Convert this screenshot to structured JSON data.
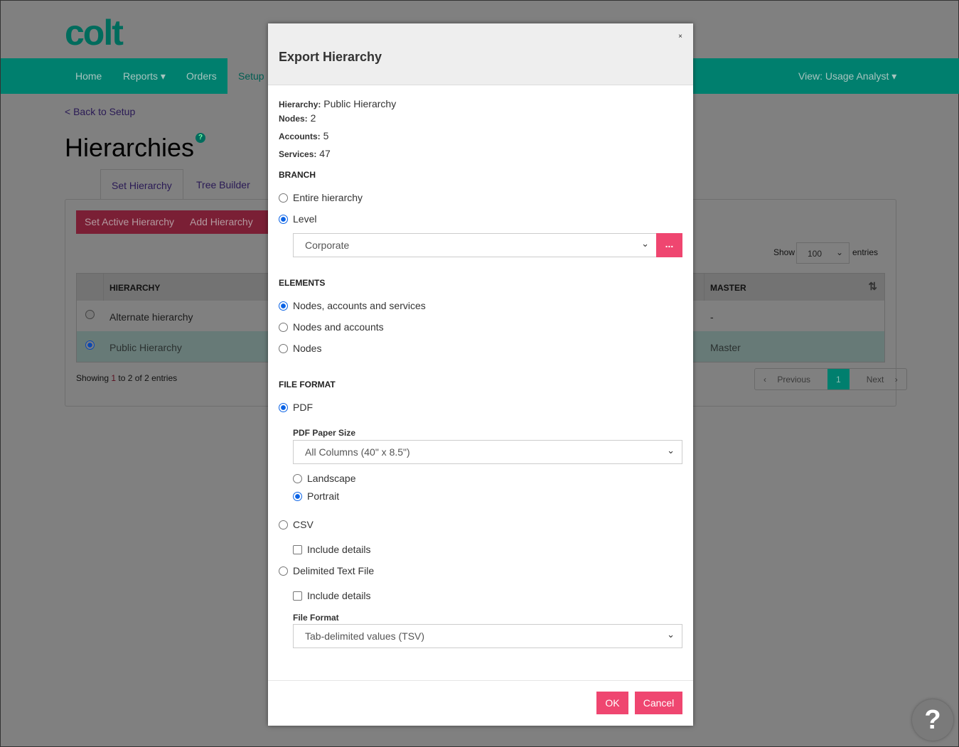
{
  "logo": "colt",
  "nav": {
    "items": [
      "Home",
      "Reports",
      "Orders",
      "Setup"
    ],
    "view": "View: Usage Analyst"
  },
  "back_link": "< Back to Setup",
  "page_title": "Hierarchies",
  "help_badge": "?",
  "tabs": [
    "Set Hierarchy",
    "Tree Builder"
  ],
  "buttons": [
    "Set Active Hierarchy",
    "Add Hierarchy"
  ],
  "show_entries": {
    "show": "Show",
    "value": "100",
    "entries": "entries"
  },
  "table": {
    "headers": [
      "HIERARCHY",
      "MASTER"
    ],
    "rows": [
      {
        "name": "Alternate hierarchy",
        "master": "-",
        "selected": false
      },
      {
        "name": "Public Hierarchy",
        "master": "Master",
        "selected": true
      }
    ]
  },
  "showing": {
    "prefix": "Showing ",
    "start": "1",
    "rest": " to 2 of 2 entries"
  },
  "pagination": {
    "previous": "Previous",
    "page": "1",
    "next": "Next"
  },
  "help_button": "?",
  "modal": {
    "title": "Export Hierarchy",
    "close": "×",
    "info": [
      {
        "label": "Hierarchy:",
        "value": "Public Hierarchy"
      },
      {
        "label": "Nodes:",
        "value": "2"
      },
      {
        "label": "Accounts:",
        "value": "5"
      },
      {
        "label": "Services:",
        "value": "47"
      }
    ],
    "branch": {
      "heading": "BRANCH",
      "options": [
        "Entire hierarchy",
        "Level"
      ],
      "selected": "Level",
      "level_value": "Corporate",
      "more": "..."
    },
    "elements": {
      "heading": "ELEMENTS",
      "options": [
        "Nodes, accounts and services",
        "Nodes and accounts",
        "Nodes"
      ],
      "selected": "Nodes, accounts and services"
    },
    "file_format": {
      "heading": "FILE FORMAT",
      "pdf": "PDF",
      "paper_size_label": "PDF Paper Size",
      "paper_size": "All Columns (40\" x 8.5\")",
      "landscape": "Landscape",
      "portrait": "Portrait",
      "csv": "CSV",
      "include_details": "Include details",
      "delimited": "Delimited Text File",
      "format_label": "File Format",
      "format_value": "Tab-delimited values (TSV)",
      "selected": "PDF",
      "orientation": "Portrait"
    },
    "ok": "OK",
    "cancel": "Cancel"
  },
  "colors": {
    "accent": "#ef4670",
    "brand_teal": "#009682",
    "radio": "#0b63e5"
  }
}
